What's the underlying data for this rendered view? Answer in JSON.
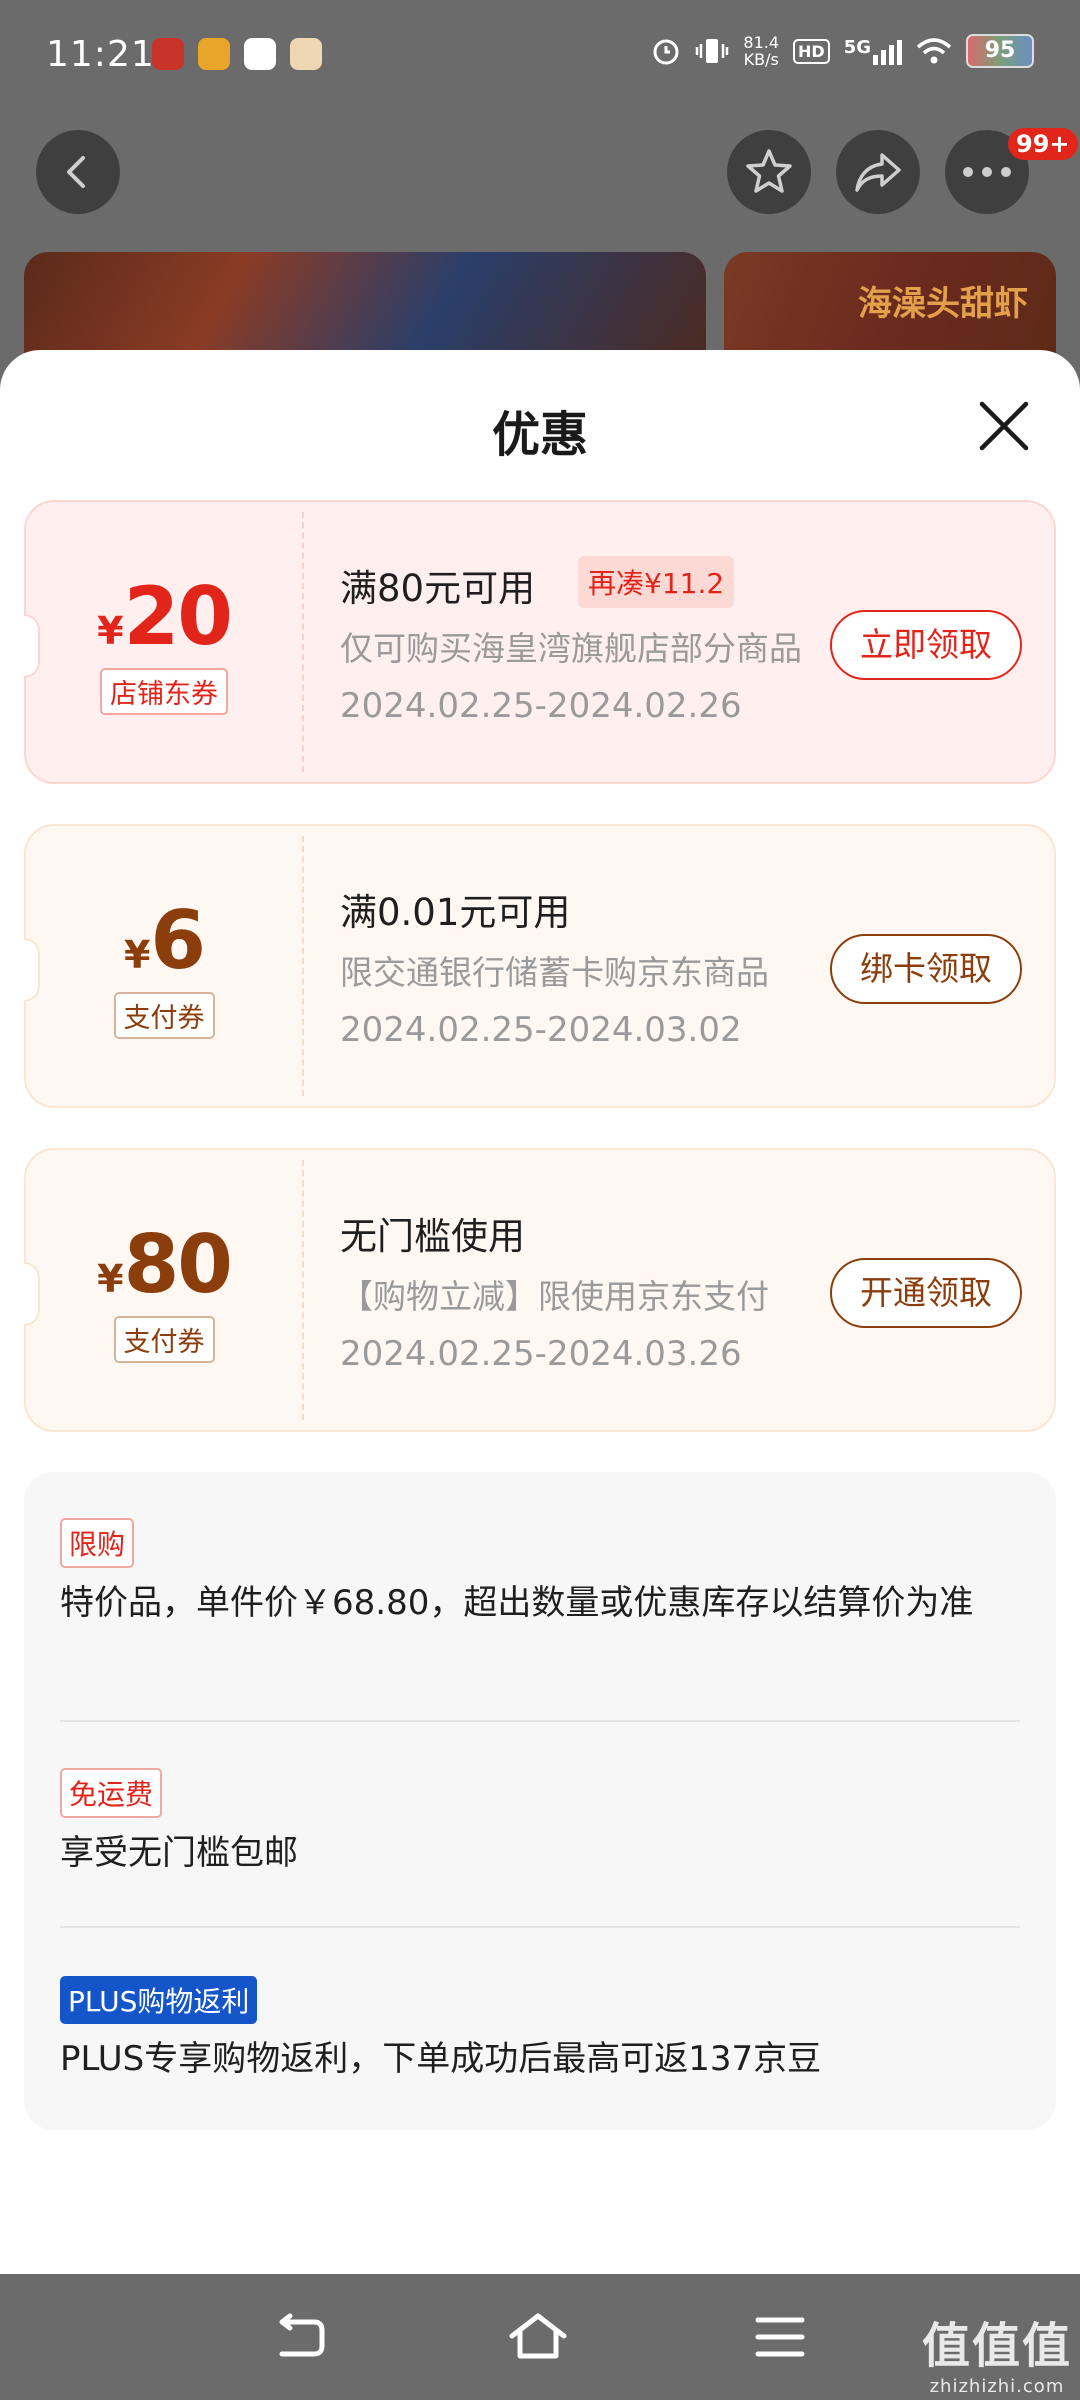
{
  "status_bar": {
    "time": "11:21",
    "net_speed_value": "81.4",
    "net_speed_unit": "KB/s",
    "hd": "HD",
    "network": "5G",
    "battery": "95"
  },
  "top_nav": {
    "notification_badge": "99+"
  },
  "background": {
    "side_product_caption": "海澡头甜虾"
  },
  "sheet": {
    "title": "优惠",
    "coupons": [
      {
        "currency": "¥",
        "amount": "20",
        "type": "店铺东券",
        "condition": "满80元可用",
        "extra": "再凑¥11.2",
        "description": "仅可购买海皇湾旗舰店部分商品",
        "date_range": "2024.02.25-2024.02.26",
        "action": "立即领取",
        "style": "red"
      },
      {
        "currency": "¥",
        "amount": "6",
        "type": "支付券",
        "condition": "满0.01元可用",
        "description": "限交通银行储蓄卡购京东商品",
        "date_range": "2024.02.25-2024.03.02",
        "action": "绑卡领取",
        "style": "cream"
      },
      {
        "currency": "¥",
        "amount": "80",
        "type": "支付券",
        "condition": "无门槛使用",
        "description": "【购物立减】限使用京东支付",
        "date_range": "2024.02.25-2024.03.26",
        "action": "开通领取",
        "style": "cream"
      }
    ],
    "promos": [
      {
        "tag": "限购",
        "text": "特价品，单件价￥68.80，超出数量或优惠库存以结算价为准"
      },
      {
        "tag": "免运费",
        "text": "享受无门槛包邮"
      },
      {
        "tag": "PLUS购物返利",
        "text": "PLUS专享购物返利，下单成功后最高可返137京豆"
      }
    ]
  },
  "watermark": {
    "brand": "值值值",
    "domain": "zhizhizhi.com"
  },
  "colors": {
    "accent_red": "#e1251b",
    "accent_brown": "#8b3d0c",
    "plus_blue": "#1456c9",
    "overlay_gray": "#6b6b6b"
  }
}
